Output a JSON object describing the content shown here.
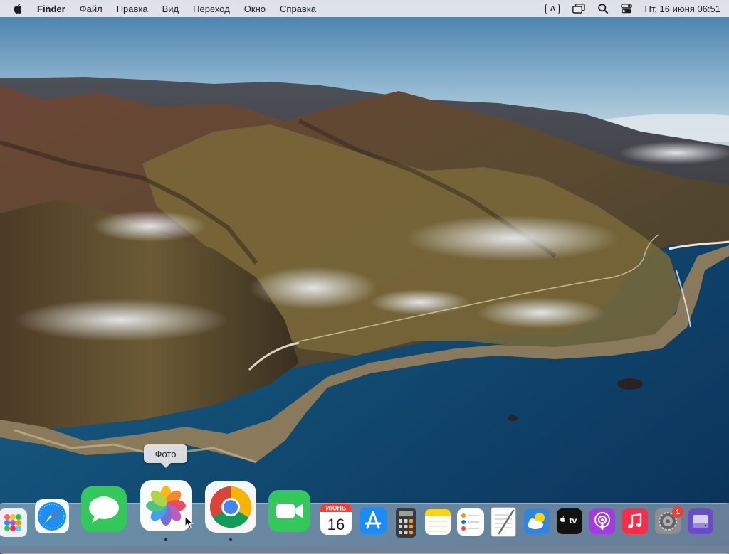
{
  "menubar": {
    "app_name": "Finder",
    "menus": [
      "Файл",
      "Правка",
      "Вид",
      "Переход",
      "Окно",
      "Справка"
    ],
    "input_source": "A",
    "clock": "Пт, 16 июня  06:51"
  },
  "tooltip": {
    "text": "Фото"
  },
  "dock": {
    "calendar": {
      "month": "ИЮНЬ",
      "day": "16"
    },
    "tv_label": "tv",
    "settings_badge": "1"
  }
}
